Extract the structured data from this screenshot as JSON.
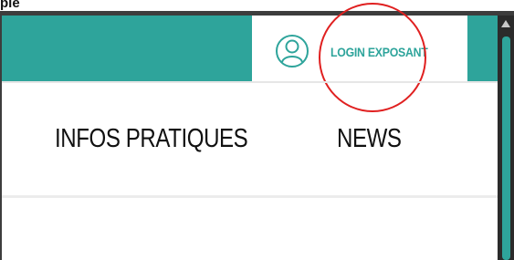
{
  "caption": "ple",
  "header": {
    "login_label": "LOGIN EXPOSANT",
    "user_icon": "user-circle-icon",
    "accent_color": "#2ea49b"
  },
  "nav": {
    "items": [
      {
        "label": "INFOS PRATIQUES"
      },
      {
        "label": "NEWS"
      }
    ]
  },
  "annotation": {
    "highlight_color": "#e02020"
  }
}
